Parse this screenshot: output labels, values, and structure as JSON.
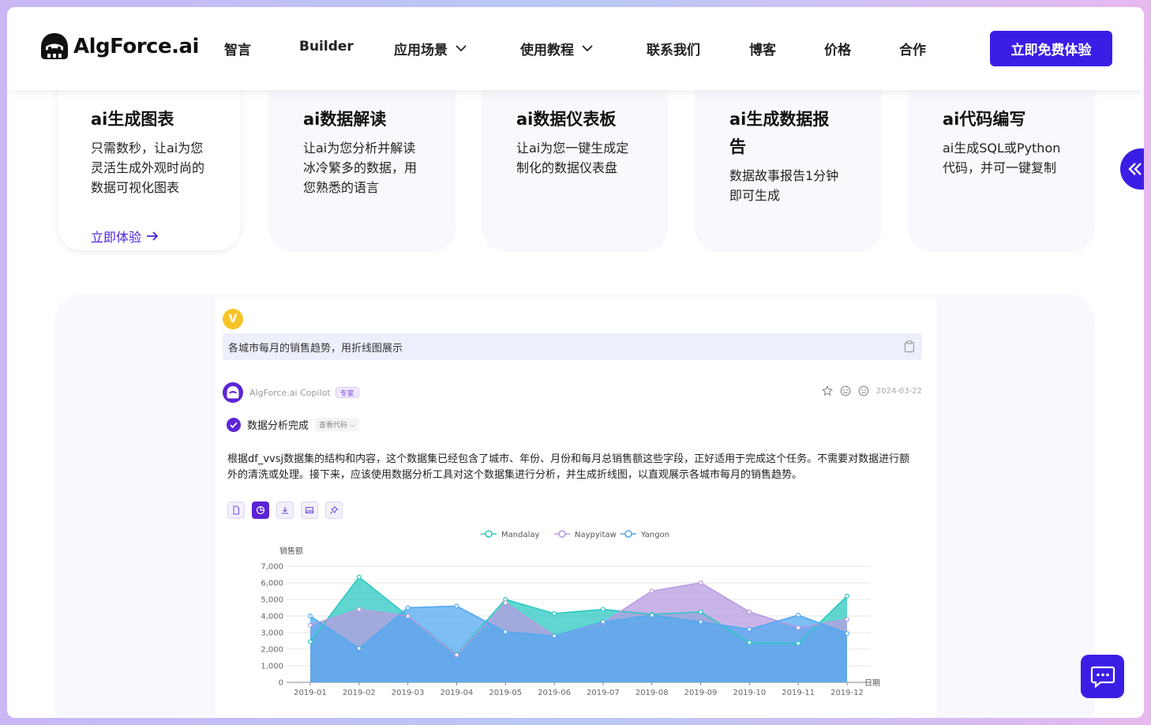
{
  "header": {
    "logo_text": "AlgForce.ai",
    "nav": [
      {
        "label": "智言"
      },
      {
        "label": "Builder"
      },
      {
        "label": "应用场景"
      },
      {
        "label": "使用教程"
      },
      {
        "label": "联系我们"
      },
      {
        "label": "博客"
      },
      {
        "label": "价格"
      },
      {
        "label": "合作"
      }
    ],
    "cta_label": "立即免费体验"
  },
  "cards": [
    {
      "title": "ai生成图表",
      "desc": "只需数秒，让ai为您灵活生成外观时尚的数据可视化图表",
      "link": "立即体验"
    },
    {
      "title": "ai数据解读",
      "desc": "让ai为您分析并解读冰冷繁多的数据，用您熟悉的语言"
    },
    {
      "title": "ai数据仪表板",
      "desc": "让ai为您一键生成定制化的数据仪表盘"
    },
    {
      "title": "ai生成数据报告",
      "desc": "数据故事报告1分钟即可生成"
    },
    {
      "title": "ai代码编写",
      "desc": "ai生成SQL或Python代码，并可一键复制"
    }
  ],
  "demo": {
    "user_initial": "V",
    "query": "各城市每月的销售趋势，用折线图展示",
    "bot_name": "AlgForce.ai Copilot",
    "bot_badge": "专家",
    "date": "2024-03-22",
    "status": "数据分析完成",
    "view_code": "查看代码",
    "analysis": "根据df_vvsj数据集的结构和内容，这个数据集已经包含了城市、年份、月份和每月总销售额这些字段，正好适用于完成这个任务。不需要对数据进行额外的清洗或处理。接下来，应该使用数据分析工具对这个数据集进行分析，并生成折线图，以直观展示各城市每月的销售趋势。"
  },
  "chart_data": {
    "type": "area",
    "x": [
      "2019-01",
      "2019-02",
      "2019-03",
      "2019-04",
      "2019-05",
      "2019-06",
      "2019-07",
      "2019-08",
      "2019-09",
      "2019-10",
      "2019-11",
      "2019-12"
    ],
    "xlabel": "日期",
    "ylabel": "销售额",
    "ylim": [
      0,
      7000
    ],
    "yticks": [
      0,
      1000,
      2000,
      3000,
      4000,
      5000,
      6000,
      7000
    ],
    "ytick_labels": [
      "0",
      "1,000",
      "2,000",
      "3,000",
      "4,000",
      "5,000",
      "6,000",
      "7,000"
    ],
    "legend_position": "top-center",
    "series": [
      {
        "name": "Mandalay",
        "color": "#2cc8c0",
        "values": [
          2450,
          6350,
          4000,
          1700,
          5000,
          4150,
          4400,
          4100,
          4250,
          2400,
          2350,
          5200
        ]
      },
      {
        "name": "Naypyitaw",
        "color": "#b79be0",
        "values": [
          3450,
          4400,
          4000,
          1650,
          4800,
          2800,
          3600,
          5500,
          6000,
          4250,
          3300,
          3800
        ]
      },
      {
        "name": "Yangon",
        "color": "#52a8f0",
        "values": [
          4000,
          2050,
          4500,
          4600,
          3050,
          2800,
          3650,
          4050,
          3650,
          3200,
          4050,
          2950
        ]
      }
    ]
  }
}
